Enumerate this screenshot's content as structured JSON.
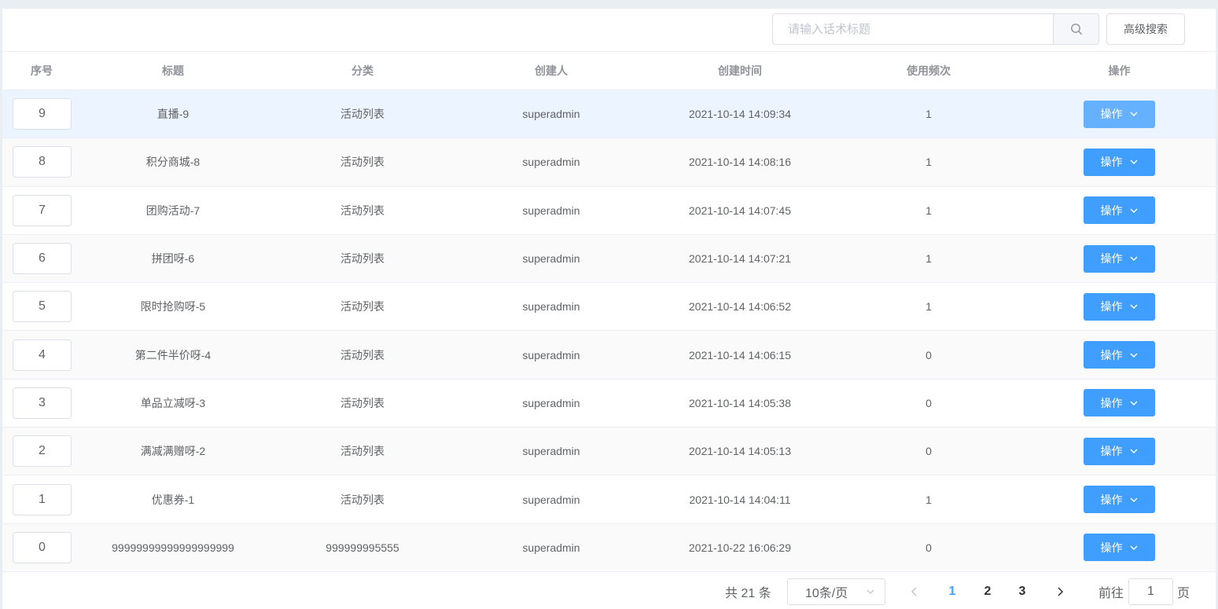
{
  "toolbar": {
    "search_placeholder": "请输入话术标题",
    "advanced_search_label": "高级搜索"
  },
  "table": {
    "headers": [
      "序号",
      "标题",
      "分类",
      "创建人",
      "创建时间",
      "使用频次",
      "操作"
    ],
    "op_label": "操作",
    "rows": [
      {
        "idx": "9",
        "title": "直播-9",
        "category": "活动列表",
        "creator": "superadmin",
        "time": "2021-10-14 14:09:34",
        "freq": "1"
      },
      {
        "idx": "8",
        "title": "积分商城-8",
        "category": "活动列表",
        "creator": "superadmin",
        "time": "2021-10-14 14:08:16",
        "freq": "1"
      },
      {
        "idx": "7",
        "title": "团购活动-7",
        "category": "活动列表",
        "creator": "superadmin",
        "time": "2021-10-14 14:07:45",
        "freq": "1"
      },
      {
        "idx": "6",
        "title": "拼团呀-6",
        "category": "活动列表",
        "creator": "superadmin",
        "time": "2021-10-14 14:07:21",
        "freq": "1"
      },
      {
        "idx": "5",
        "title": "限时抢购呀-5",
        "category": "活动列表",
        "creator": "superadmin",
        "time": "2021-10-14 14:06:52",
        "freq": "1"
      },
      {
        "idx": "4",
        "title": "第二件半价呀-4",
        "category": "活动列表",
        "creator": "superadmin",
        "time": "2021-10-14 14:06:15",
        "freq": "0"
      },
      {
        "idx": "3",
        "title": "单品立减呀-3",
        "category": "活动列表",
        "creator": "superadmin",
        "time": "2021-10-14 14:05:38",
        "freq": "0"
      },
      {
        "idx": "2",
        "title": "满减满赠呀-2",
        "category": "活动列表",
        "creator": "superadmin",
        "time": "2021-10-14 14:05:13",
        "freq": "0"
      },
      {
        "idx": "1",
        "title": "优惠券-1",
        "category": "活动列表",
        "creator": "superadmin",
        "time": "2021-10-14 14:04:11",
        "freq": "1"
      },
      {
        "idx": "0",
        "title": "99999999999999999999",
        "category": "999999995555",
        "creator": "superadmin",
        "time": "2021-10-22 16:06:29",
        "freq": "0"
      }
    ]
  },
  "pagination": {
    "total_text": "共 21 条",
    "page_size": "10条/页",
    "pages": [
      "1",
      "2",
      "3"
    ],
    "current_page": "1",
    "goto_prefix": "前往",
    "goto_value": "1",
    "goto_suffix": "页"
  },
  "colors": {
    "primary": "#409eff",
    "primary_hover": "#66b1ff",
    "row_hover": "#ecf5ff"
  }
}
